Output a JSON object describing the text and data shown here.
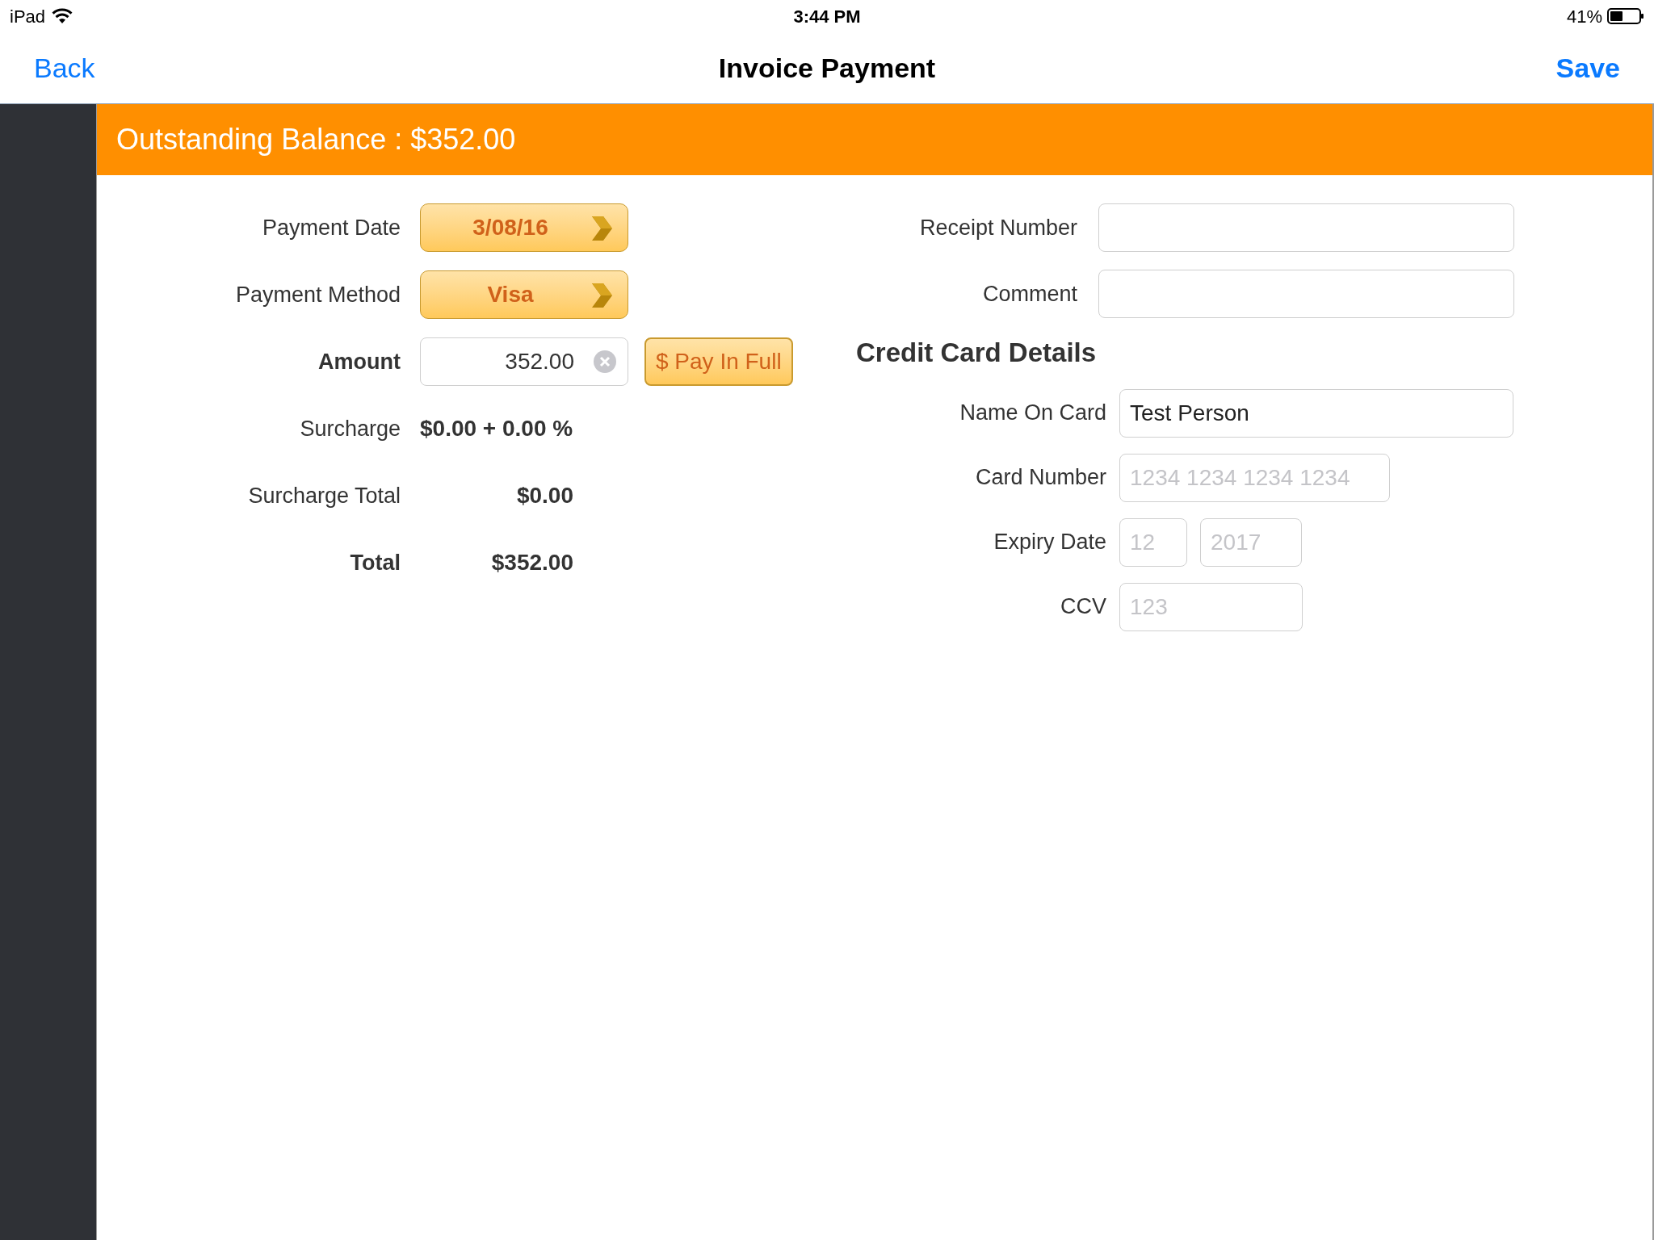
{
  "status_bar": {
    "device": "iPad",
    "time": "3:44 PM",
    "battery": "41%"
  },
  "nav": {
    "back": "Back",
    "title": "Invoice Payment",
    "save": "Save"
  },
  "banner": "Outstanding Balance : $352.00",
  "payment_fields": [
    {
      "kind": "picker",
      "label": "Payment Date",
      "value": "3/08/16"
    },
    {
      "kind": "picker",
      "label": "Payment Method",
      "value": "Visa"
    },
    {
      "kind": "amount",
      "label": "Amount",
      "value": "352.00",
      "button": "$ Pay In Full"
    },
    {
      "kind": "value",
      "label": "Surcharge",
      "value": "$0.00 + 0.00 %"
    },
    {
      "kind": "total",
      "label": "Surcharge Total",
      "value": "$0.00"
    },
    {
      "kind": "grand_total",
      "label": "Total",
      "value": "$352.00"
    }
  ],
  "receipt_fields": [
    {
      "label": "Receipt Number"
    },
    {
      "label": "Comment"
    }
  ],
  "card_section": {
    "title": "Credit Card Details",
    "fields": [
      {
        "kind": "name",
        "label": "Name On Card",
        "inputs": [
          {
            "value": "Test Person"
          }
        ]
      },
      {
        "kind": "number",
        "label": "Card Number",
        "inputs": [
          {
            "placeholder": "1234 1234 1234 1234"
          }
        ]
      },
      {
        "kind": "expiry",
        "label": "Expiry Date",
        "inputs": [
          {
            "placeholder": "12"
          },
          {
            "placeholder": "2017"
          }
        ]
      },
      {
        "kind": "ccv",
        "label": "CCV",
        "inputs": [
          {
            "placeholder": "123"
          }
        ]
      }
    ]
  }
}
